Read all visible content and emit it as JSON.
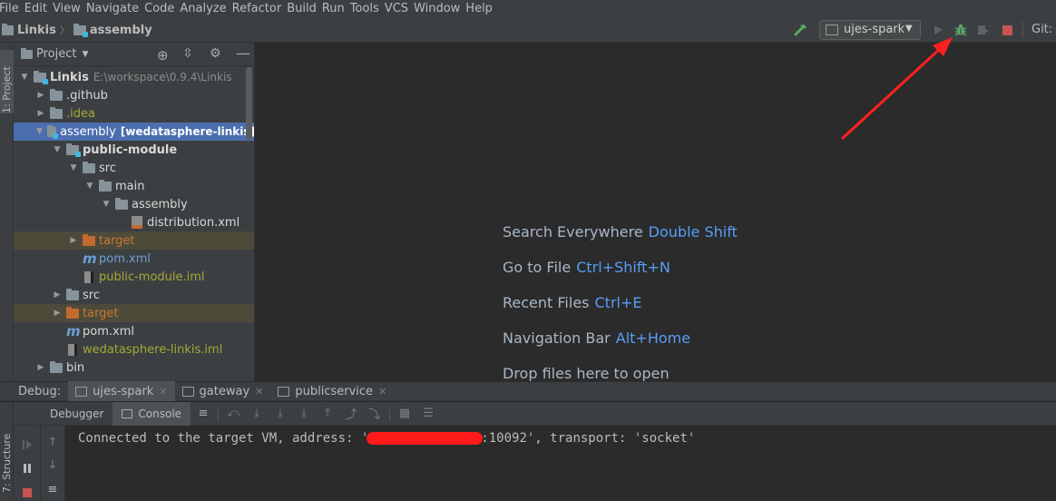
{
  "menu": [
    "File",
    "Edit",
    "View",
    "Navigate",
    "Code",
    "Analyze",
    "Refactor",
    "Build",
    "Run",
    "Tools",
    "VCS",
    "Window",
    "Help"
  ],
  "nav": {
    "project": "Linkis",
    "module": "assembly",
    "run_config": "ujes-spark",
    "git_label": "Git:"
  },
  "left_strip": {
    "project_tab": "1: Project",
    "structure_tab": "7: Structure"
  },
  "project_panel": {
    "title": "Project",
    "tree": [
      {
        "label": "Linkis",
        "suffix": "E:\\workspace\\0.9.4\\Linkis",
        "depth": 0,
        "expanded": true,
        "icon": "module-folder-icon",
        "style": "bold-white"
      },
      {
        "label": ".github",
        "depth": 1,
        "expanded": false,
        "icon": "folder-icon",
        "style": "white"
      },
      {
        "label": ".idea",
        "depth": 1,
        "expanded": false,
        "icon": "folder-icon",
        "style": "olive"
      },
      {
        "label": "assembly",
        "suffix": "[wedatasphere-linkis]",
        "depth": 1,
        "expanded": true,
        "icon": "module-folder-icon",
        "style": "selected"
      },
      {
        "label": "public-module",
        "depth": 2,
        "expanded": true,
        "icon": "module-folder-icon",
        "style": "bold-white"
      },
      {
        "label": "src",
        "depth": 3,
        "expanded": true,
        "icon": "folder-icon",
        "style": "white"
      },
      {
        "label": "main",
        "depth": 4,
        "expanded": true,
        "icon": "folder-icon",
        "style": "white"
      },
      {
        "label": "assembly",
        "depth": 5,
        "expanded": true,
        "icon": "folder-icon",
        "style": "white"
      },
      {
        "label": "distribution.xml",
        "depth": 6,
        "expanded": null,
        "icon": "xml-file-icon",
        "style": "white"
      },
      {
        "label": "target",
        "depth": 3,
        "expanded": false,
        "icon": "excluded-folder-icon",
        "style": "orange"
      },
      {
        "label": "pom.xml",
        "depth": 3,
        "expanded": null,
        "icon": "maven-icon",
        "style": "blue"
      },
      {
        "label": "public-module.iml",
        "depth": 3,
        "expanded": null,
        "icon": "iml-file-icon",
        "style": "olive"
      },
      {
        "label": "src",
        "depth": 2,
        "expanded": false,
        "icon": "folder-icon",
        "style": "white"
      },
      {
        "label": "target",
        "depth": 2,
        "expanded": false,
        "icon": "excluded-folder-icon",
        "style": "orange"
      },
      {
        "label": "pom.xml",
        "depth": 2,
        "expanded": null,
        "icon": "maven-icon",
        "style": "white"
      },
      {
        "label": "wedatasphere-linkis.iml",
        "depth": 2,
        "expanded": null,
        "icon": "iml-file-icon",
        "style": "olive"
      },
      {
        "label": "bin",
        "depth": 1,
        "expanded": false,
        "icon": "folder-icon",
        "style": "white"
      }
    ]
  },
  "editor_hints": [
    {
      "text": "Search Everywhere",
      "key": "Double Shift"
    },
    {
      "text": "Go to File",
      "key": "Ctrl+Shift+N"
    },
    {
      "text": "Recent Files",
      "key": "Ctrl+E"
    },
    {
      "text": "Navigation Bar",
      "key": "Alt+Home"
    },
    {
      "text": "Drop files here to open",
      "key": ""
    }
  ],
  "debug": {
    "label": "Debug:",
    "sessions": [
      "ujes-spark",
      "gateway",
      "publicservice"
    ],
    "subtabs": [
      "Debugger",
      "Console"
    ],
    "console_line": {
      "before": "Connected to the target VM, address: '",
      "after": ":10092', transport: 'socket'"
    }
  },
  "colors": {
    "accent": "#4b6eaf",
    "annotation_arrow": "#ff2020",
    "debug_icon": "#59a869",
    "stop": "#c75450"
  }
}
